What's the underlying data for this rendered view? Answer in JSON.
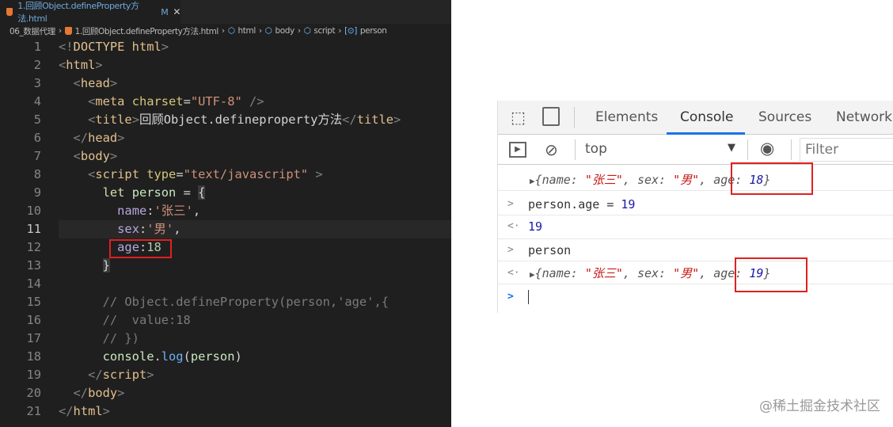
{
  "editor": {
    "tab": {
      "label": "1.回顾Object.defineProperty方法.html",
      "modified": "M",
      "close": "✕"
    },
    "breadcrumbs": [
      "06_数据代理",
      "1.回顾Object.defineProperty方法.html",
      "html",
      "body",
      "script",
      "person"
    ],
    "current_line": 11,
    "highlighted_line": 12,
    "lines": [
      {
        "n": "1",
        "i": 0,
        "t": [
          [
            "<!",
            "p"
          ],
          [
            "DOCTYPE html",
            "tg"
          ],
          [
            ">",
            "p"
          ]
        ]
      },
      {
        "n": "2",
        "i": 0,
        "t": [
          [
            "<",
            "p"
          ],
          [
            "html",
            "tg"
          ],
          [
            ">",
            "p"
          ]
        ]
      },
      {
        "n": "3",
        "i": 2,
        "t": [
          [
            "<",
            "p"
          ],
          [
            "head",
            "tg"
          ],
          [
            ">",
            "p"
          ]
        ]
      },
      {
        "n": "4",
        "i": 4,
        "t": [
          [
            "<",
            "p"
          ],
          [
            "meta ",
            "tg"
          ],
          [
            "charset",
            "at"
          ],
          [
            "=",
            "d"
          ],
          [
            "\"UTF-8\"",
            "s"
          ],
          [
            " />",
            "p"
          ]
        ]
      },
      {
        "n": "5",
        "i": 4,
        "t": [
          [
            "<",
            "p"
          ],
          [
            "title",
            "tg"
          ],
          [
            ">",
            "p"
          ],
          [
            "回顾Object.defineproperty方法",
            "d"
          ],
          [
            "</",
            "p"
          ],
          [
            "title",
            "tg"
          ],
          [
            ">",
            "p"
          ]
        ]
      },
      {
        "n": "6",
        "i": 2,
        "t": [
          [
            "</",
            "p"
          ],
          [
            "head",
            "tg"
          ],
          [
            ">",
            "p"
          ]
        ]
      },
      {
        "n": "7",
        "i": 2,
        "t": [
          [
            "<",
            "p"
          ],
          [
            "body",
            "tg"
          ],
          [
            ">",
            "p"
          ]
        ]
      },
      {
        "n": "8",
        "i": 4,
        "t": [
          [
            "<",
            "p"
          ],
          [
            "script ",
            "tg"
          ],
          [
            "type",
            "at"
          ],
          [
            "=",
            "d"
          ],
          [
            "\"text/javascript\"",
            "s"
          ],
          [
            " >",
            "p"
          ]
        ]
      },
      {
        "n": "9",
        "i": 6,
        "t": [
          [
            "let ",
            "kw"
          ],
          [
            "person",
            "n"
          ],
          [
            " = ",
            "d"
          ],
          [
            "{",
            "b"
          ]
        ]
      },
      {
        "n": "10",
        "i": 8,
        "t": [
          [
            "name",
            "pr"
          ],
          [
            ":",
            "d"
          ],
          [
            "'张三'",
            "s"
          ],
          [
            ",",
            "d"
          ]
        ]
      },
      {
        "n": "11",
        "i": 8,
        "t": [
          [
            "sex",
            "pr"
          ],
          [
            ":",
            "d"
          ],
          [
            "'男'",
            "s"
          ],
          [
            ",",
            "d"
          ]
        ]
      },
      {
        "n": "12",
        "i": 8,
        "t": [
          [
            "age",
            "pr"
          ],
          [
            ":",
            "d"
          ],
          [
            "18",
            "v"
          ]
        ]
      },
      {
        "n": "13",
        "i": 6,
        "t": [
          [
            "}",
            "b"
          ]
        ]
      },
      {
        "n": "14",
        "i": 0,
        "t": []
      },
      {
        "n": "15",
        "i": 6,
        "t": [
          [
            "// Object.defineProperty(person,'age',{",
            "c"
          ]
        ]
      },
      {
        "n": "16",
        "i": 6,
        "t": [
          [
            "//  value:18",
            "c"
          ]
        ]
      },
      {
        "n": "17",
        "i": 6,
        "t": [
          [
            "// })",
            "c"
          ]
        ]
      },
      {
        "n": "18",
        "i": 6,
        "t": [
          [
            "console",
            "n"
          ],
          [
            ".",
            "d"
          ],
          [
            "log",
            "f"
          ],
          [
            "(",
            "d"
          ],
          [
            "person",
            "n"
          ],
          [
            ")",
            "d"
          ]
        ]
      },
      {
        "n": "19",
        "i": 4,
        "t": [
          [
            "</",
            "p"
          ],
          [
            "script",
            "tg"
          ],
          [
            ">",
            "p"
          ]
        ]
      },
      {
        "n": "20",
        "i": 2,
        "t": [
          [
            "</",
            "p"
          ],
          [
            "body",
            "tg"
          ],
          [
            ">",
            "p"
          ]
        ]
      },
      {
        "n": "21",
        "i": 0,
        "t": [
          [
            "</",
            "p"
          ],
          [
            "html",
            "tg"
          ],
          [
            ">",
            "p"
          ]
        ]
      }
    ]
  },
  "devtools": {
    "tabs": [
      "Elements",
      "Console",
      "Sources",
      "Network"
    ],
    "active_tab": "Console",
    "context": "top",
    "filter_placeholder": "Filter",
    "console": {
      "log1": {
        "pre": "{",
        "k1": "name: ",
        "v1": "\"张三\"",
        "k2": ", sex: ",
        "v2": "\"男\"",
        "k3": ", ",
        "k4": "age: ",
        "v3": "18",
        "post": "}"
      },
      "input1": {
        "prefix": "person.age = ",
        "value": "19"
      },
      "result1": "19",
      "input2": "person",
      "log2": {
        "pre": "{",
        "k1": "name: ",
        "v1": "\"张三\"",
        "k2": ", sex: ",
        "v2": "\"男\"",
        "k3": ", ",
        "k4": "age: ",
        "v3": "19",
        "post": "}"
      }
    },
    "colors": {
      "accent": "#1a73e8",
      "highlight_box": "#e02020"
    }
  },
  "watermark": "@稀土掘金技术社区"
}
